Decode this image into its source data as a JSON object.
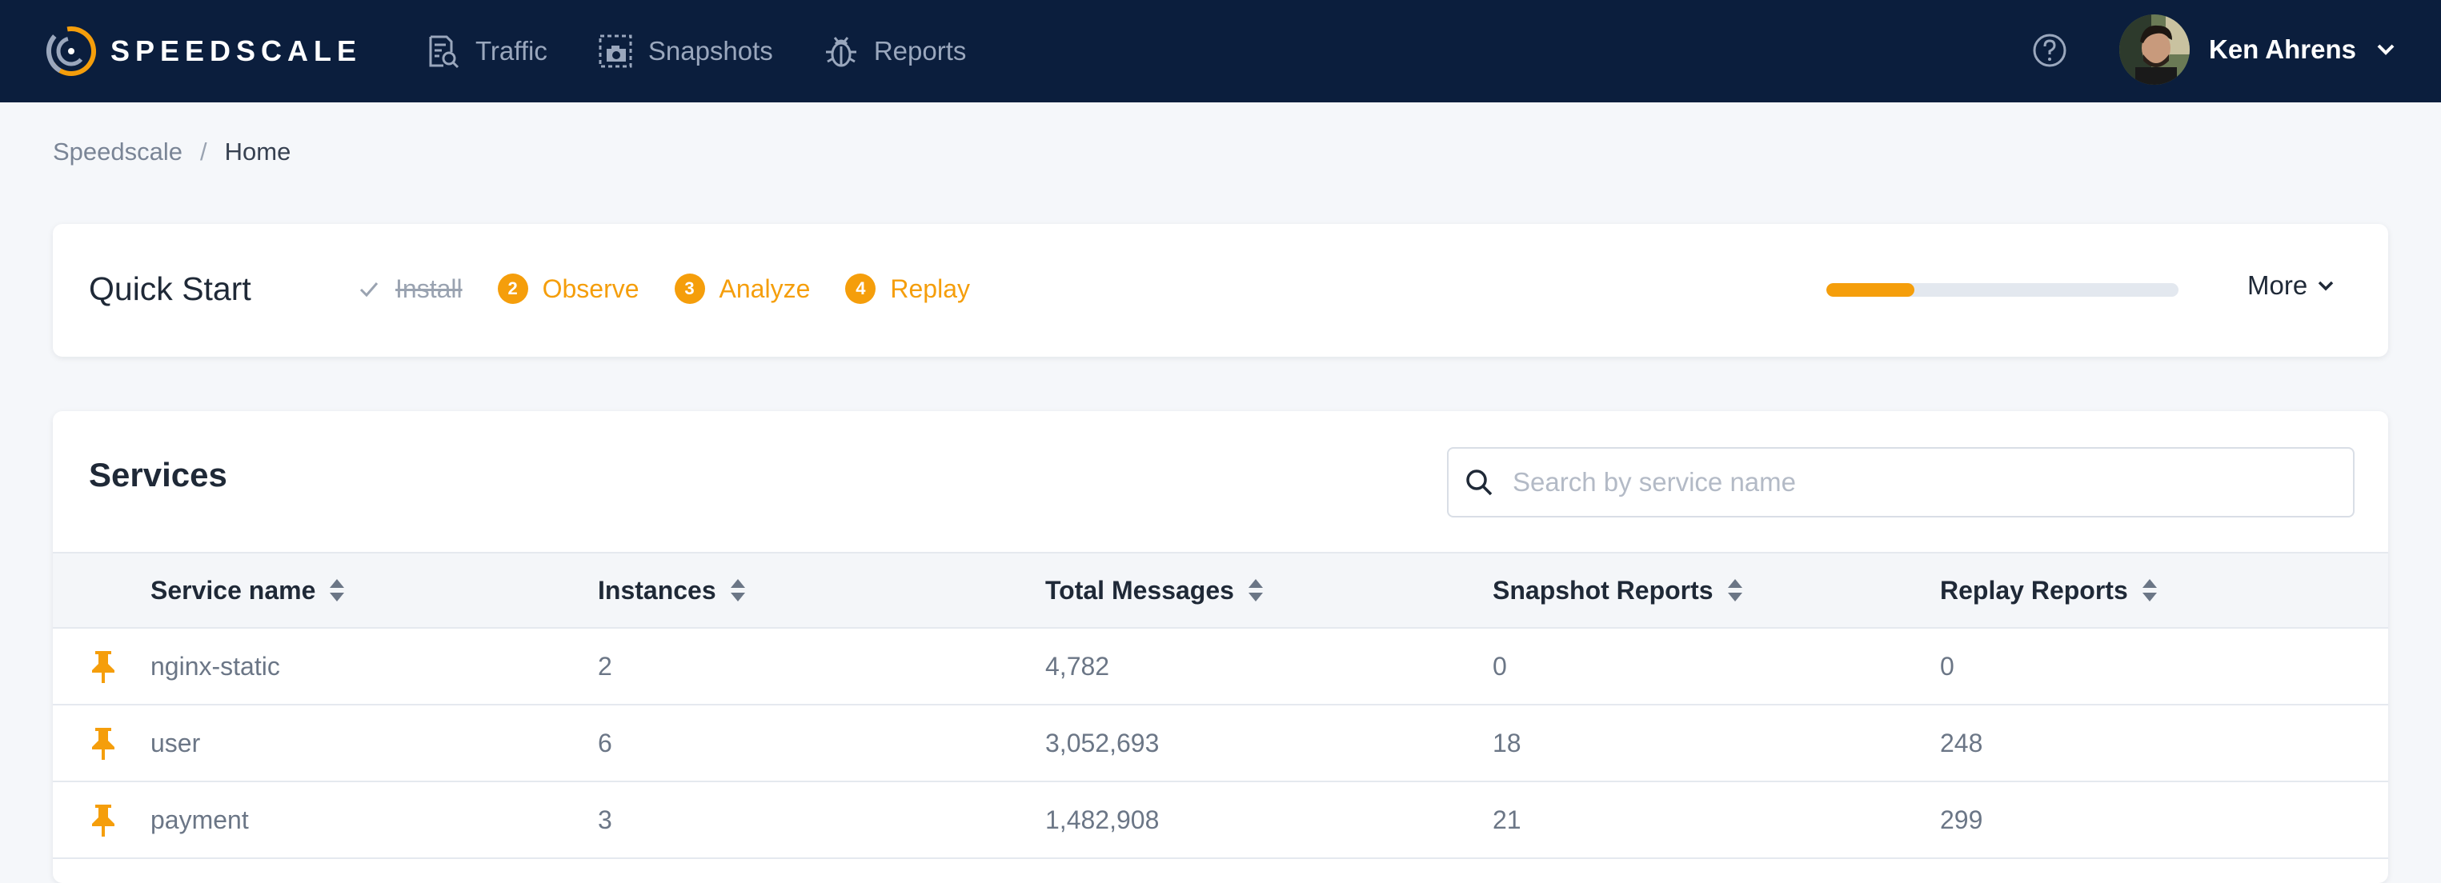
{
  "colors": {
    "topbar": "#0b1e3d",
    "accent": "#f59e0b",
    "nav_text": "#9aa7bd",
    "page_bg": "#f5f7fa"
  },
  "brand": {
    "name": "SPEEDSCALE",
    "logo_icon": "speedscale-logo-icon"
  },
  "nav": {
    "items": [
      {
        "label": "Traffic",
        "icon": "traffic-icon"
      },
      {
        "label": "Snapshots",
        "icon": "snapshot-camera-icon"
      },
      {
        "label": "Reports",
        "icon": "bug-report-icon"
      }
    ]
  },
  "user": {
    "name": "Ken Ahrens",
    "help_icon": "help-icon",
    "menu_icon": "chevron-down-icon"
  },
  "breadcrumb": {
    "root": "Speedscale",
    "separator": "/",
    "current": "Home"
  },
  "quickstart": {
    "title": "Quick Start",
    "steps": [
      {
        "label": "Install",
        "number": "",
        "done": true
      },
      {
        "label": "Observe",
        "number": "2",
        "done": false
      },
      {
        "label": "Analyze",
        "number": "3",
        "done": false
      },
      {
        "label": "Replay",
        "number": "4",
        "done": false
      }
    ],
    "progress_fraction": 0.25,
    "more_label": "More"
  },
  "services": {
    "title": "Services",
    "search_placeholder": "Search by service name",
    "search_value": "",
    "columns": [
      "Service name",
      "Instances",
      "Total Messages",
      "Snapshot Reports",
      "Replay Reports"
    ],
    "rows": [
      {
        "pinned": true,
        "cells": [
          "nginx-static",
          "2",
          "4,782",
          "0",
          "0"
        ]
      },
      {
        "pinned": true,
        "cells": [
          "user",
          "6",
          "3,052,693",
          "18",
          "248"
        ]
      },
      {
        "pinned": true,
        "cells": [
          "payment",
          "3",
          "1,482,908",
          "21",
          "299"
        ]
      }
    ]
  }
}
